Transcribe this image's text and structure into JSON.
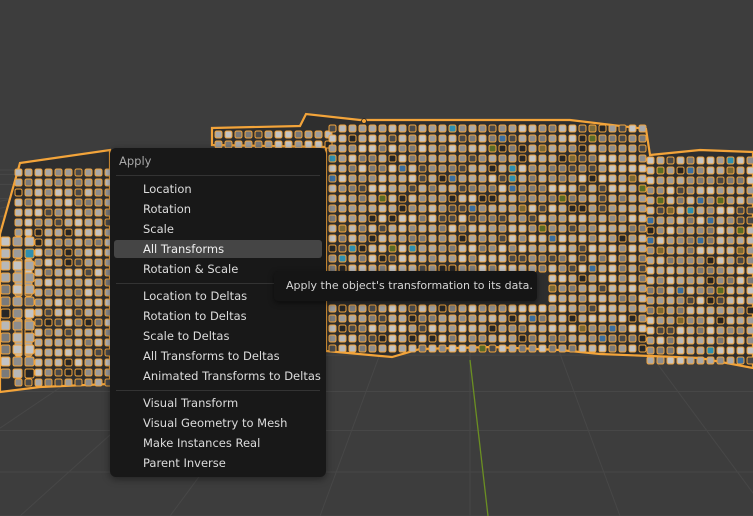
{
  "menu": {
    "title": "Apply",
    "items": [
      {
        "label": "Location",
        "group": 1
      },
      {
        "label": "Rotation",
        "group": 1
      },
      {
        "label": "Scale",
        "group": 1
      },
      {
        "label": "All Transforms",
        "group": 1,
        "active": true
      },
      {
        "label": "Rotation & Scale",
        "group": 1
      },
      {
        "label": "Location to Deltas",
        "group": 2
      },
      {
        "label": "Rotation to Deltas",
        "group": 2
      },
      {
        "label": "Scale to Deltas",
        "group": 2
      },
      {
        "label": "All Transforms to Deltas",
        "group": 2
      },
      {
        "label": "Animated Transforms to Deltas",
        "group": 2
      },
      {
        "label": "Visual Transform",
        "group": 3
      },
      {
        "label": "Visual Geometry to Mesh",
        "group": 3
      },
      {
        "label": "Make Instances Real",
        "group": 3
      },
      {
        "label": "Parent Inverse",
        "group": 3
      }
    ]
  },
  "tooltip": {
    "text": "Apply the object's transformation to its data."
  },
  "colors": {
    "viewport_bg": "#3d3d3d",
    "grid_line": "#474747",
    "y_axis": "#6b8f22",
    "selection_outline": "#f3a43a",
    "menu_bg": "#181818",
    "menu_highlight": "#454545"
  }
}
